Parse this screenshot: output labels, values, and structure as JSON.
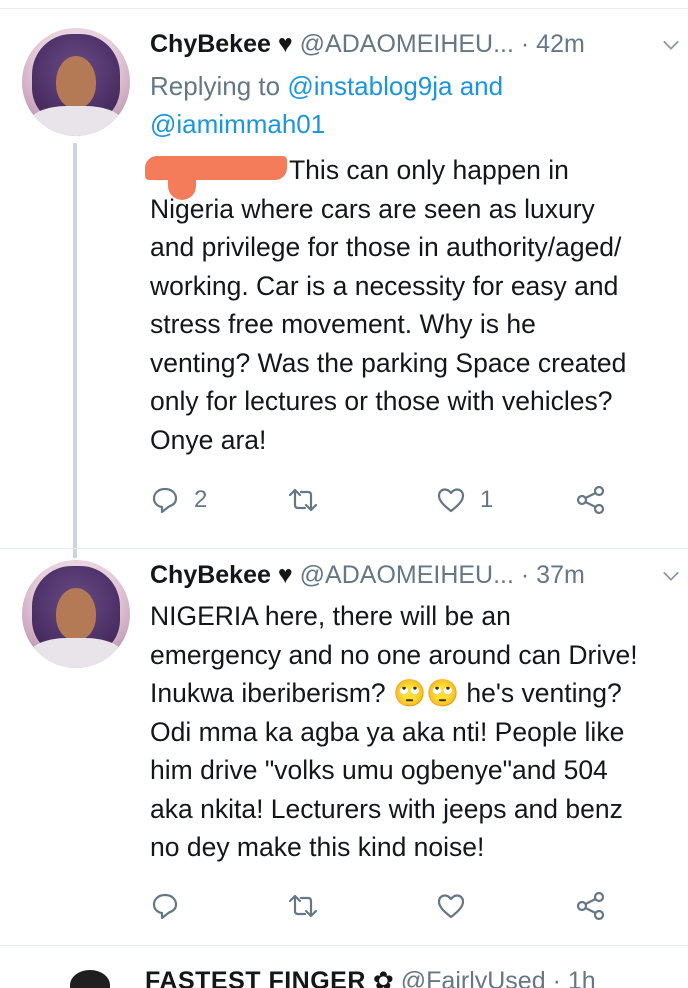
{
  "tweets": [
    {
      "name": "ChyBekee ♥",
      "handle": "@ADAOMEIHEU...",
      "time": "· 42m",
      "reply_prefix": "Replying to ",
      "reply_to_1": "@instablog9ja",
      "reply_and": " and",
      "reply_to_2": "@iamimmah01",
      "text_first_line": "This can only happen in",
      "text_rest": "Nigeria where cars are seen as luxury\nand privilege for those in authority/aged/\nworking. Car is a necessity for easy and\nstress free movement. Why is he\nventing? Was the parking Space created\nonly for lectures or those with vehicles?\nOnye ara!",
      "reply_count": "2",
      "retweet_count": "",
      "like_count": "1"
    },
    {
      "name": "ChyBekee ♥",
      "handle": "@ADAOMEIHEU...",
      "time": "· 37m",
      "text": "NIGERIA here, there will be an\nemergency and no one around can Drive!\nInukwa iberiberism? 🙄🙄 he's venting?\nOdi mma ka agba ya aka nti! People like\nhim drive \"volks umu ogbenye\"and 504\naka nkita! Lecturers with jeeps and benz\nno dey make this kind noise!",
      "reply_count": "",
      "retweet_count": "",
      "like_count": ""
    }
  ],
  "peek": {
    "name": "FASTEST FINGER",
    "handle": "@FairlyUsed",
    "time": "· 1h"
  },
  "icons": [
    "reply-icon",
    "retweet-icon",
    "like-icon",
    "share-icon",
    "chevron-down-icon"
  ],
  "colors": {
    "link": "#1b95e0",
    "muted": "#657786",
    "text": "#14171a",
    "divider": "#e6ecf0"
  }
}
